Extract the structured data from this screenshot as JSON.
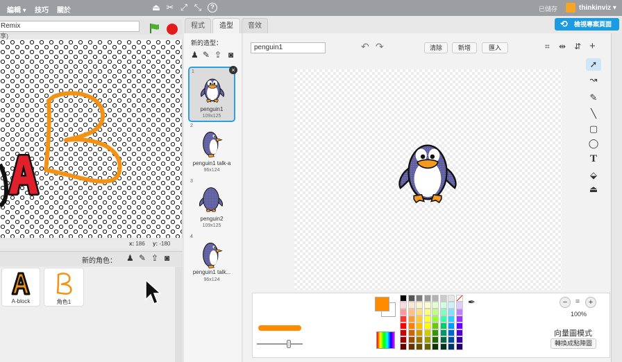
{
  "menubar": {
    "edit": "編輯 ▾",
    "tips": "技巧",
    "about": "關於",
    "saved": "已儲存",
    "username": "thinkinviz ▾"
  },
  "stage": {
    "project_name": "Remix",
    "author": "享)",
    "x_label": "x:",
    "x_value": "186",
    "y_label": "y:",
    "y_value": "-180"
  },
  "sprites": {
    "new_sprite_label": "新的角色：",
    "items": [
      {
        "name": "A-block"
      },
      {
        "name": "角色1"
      }
    ]
  },
  "tabs": [
    {
      "label": "程式"
    },
    {
      "label": "造型"
    },
    {
      "label": "音效"
    }
  ],
  "view_project_button": "檢視專案頁面",
  "costumes": {
    "new_costume_label": "新的造型：",
    "items": [
      {
        "num": "1",
        "name": "penguin1",
        "size": "109x125"
      },
      {
        "num": "2",
        "name": "penguin1 talk-a",
        "size": "96x124"
      },
      {
        "num": "3",
        "name": "penguin2",
        "size": "109x125"
      },
      {
        "num": "4",
        "name": "penguin1 talk...",
        "size": "96x124"
      }
    ]
  },
  "editor": {
    "costume_name": "penguin1",
    "clear_button": "清除",
    "add_button": "新增",
    "import_button": "匯入",
    "zoom_level": "100%",
    "mode_label": "向量圖模式",
    "convert_button": "轉換成點陣圖",
    "fill_color": "#ff8c00"
  },
  "palette": [
    "#000000",
    "#555555",
    "#7a7a7a",
    "#999999",
    "#b3b3b3",
    "#cccccc",
    "#e6e6e6",
    "#ffffff",
    "#ffd9d9",
    "#ffe9cc",
    "#fff4cc",
    "#ffffcc",
    "#e5ffcc",
    "#ccffe5",
    "#ccf2ff",
    "#e0ccff",
    "#ff9999",
    "#ffc080",
    "#ffe080",
    "#ffff80",
    "#c0ff80",
    "#80ffc0",
    "#80e0ff",
    "#c080ff",
    "#ff3333",
    "#ff9933",
    "#ffcc33",
    "#ffff33",
    "#99ff33",
    "#33ffaa",
    "#33ccff",
    "#9933ff",
    "#ff0000",
    "#ff7f00",
    "#ffbf00",
    "#ffff00",
    "#66cc00",
    "#00cc66",
    "#0099ff",
    "#6600ff",
    "#cc0000",
    "#cc6600",
    "#cc9900",
    "#cccc00",
    "#339900",
    "#009966",
    "#0066cc",
    "#5500cc",
    "#990000",
    "#994c00",
    "#997300",
    "#999900",
    "#1f6600",
    "#006644",
    "#004c99",
    "#330099",
    "#660000",
    "#663300",
    "#664d00",
    "#666600",
    "#0f3300",
    "#003322",
    "#003366",
    "#220066"
  ]
}
